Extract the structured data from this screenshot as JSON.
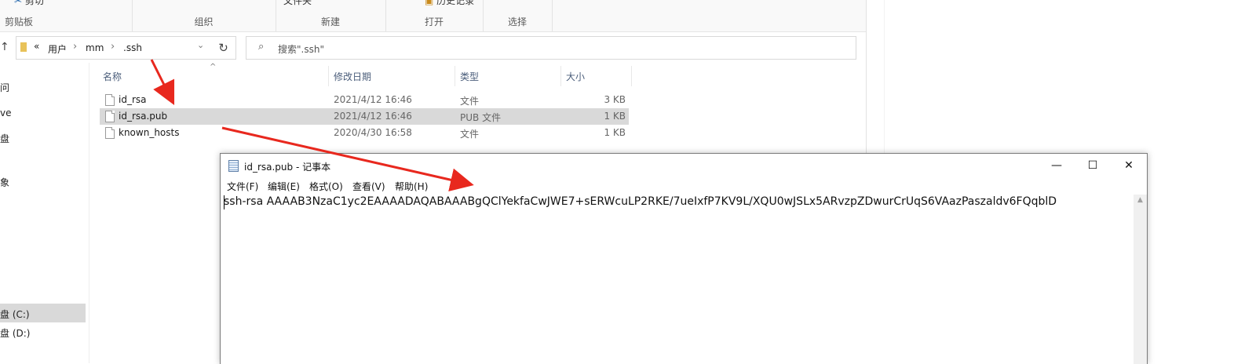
{
  "ribbon": {
    "clipboard": {
      "top_item": "剪切",
      "label": "剪贴板"
    },
    "organize": {
      "label": "组织"
    },
    "new": {
      "top_item": "文件夹",
      "label": "新建"
    },
    "open": {
      "top_item": "历史记录",
      "label": "打开"
    },
    "select": {
      "label": "选择"
    }
  },
  "address": {
    "overflow": "«",
    "crumbs": [
      "用户",
      "mm",
      ".ssh"
    ],
    "refresh_icon": "refresh-icon"
  },
  "search": {
    "placeholder": "搜索\".ssh\""
  },
  "nav": {
    "items": [
      "问",
      "ve",
      "盘",
      "象",
      "盘 (C:)",
      "盘 (D:)"
    ],
    "selected": "盘 (C:)"
  },
  "columns": {
    "name": "名称",
    "modified": "修改日期",
    "type": "类型",
    "size": "大小"
  },
  "files": [
    {
      "name": "id_rsa",
      "modified": "2021/4/12 16:46",
      "type": "文件",
      "size": "3 KB"
    },
    {
      "name": "id_rsa.pub",
      "modified": "2021/4/12 16:46",
      "type": "PUB 文件",
      "size": "1 KB",
      "selected": true
    },
    {
      "name": "known_hosts",
      "modified": "2020/4/30 16:58",
      "type": "文件",
      "size": "1 KB"
    }
  ],
  "notepad": {
    "title": "id_rsa.pub - 记事本",
    "menu": [
      "文件(F)",
      "编辑(E)",
      "格式(O)",
      "查看(V)",
      "帮助(H)"
    ],
    "content": "ssh-rsa AAAAB3NzaC1yc2EAAAADAQABAAABgQClYekfaCwJWE7+sERWcuLP2RKE/7ueIxfP7KV9L/XQU0wJSLx5ARvzpZDwurCrUqS6VAazPaszaldv6FQqblD",
    "buttons": {
      "minimize": "—",
      "maximize": "☐",
      "close": "✕"
    }
  },
  "colors": {
    "arrow": "#e8281e",
    "selection": "#d9d9d9",
    "header_text": "#4a5d7a"
  }
}
